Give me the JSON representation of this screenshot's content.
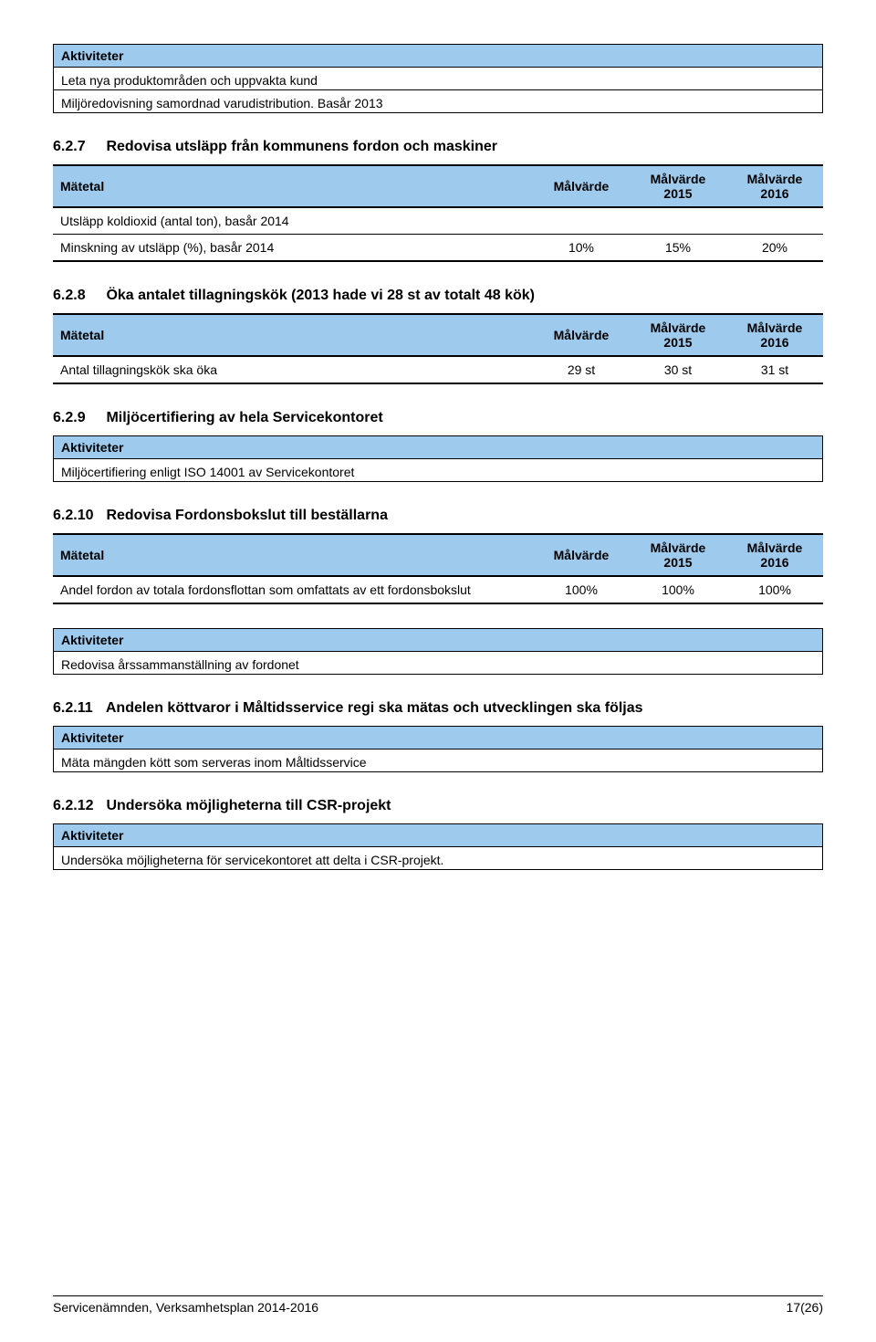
{
  "labels": {
    "aktiviteter": "Aktiviteter",
    "matetal": "Mätetal",
    "malvarde": "Målvärde",
    "malvarde_2015": "Målvärde\n2015",
    "malvarde_2016": "Målvärde\n2016"
  },
  "block_intro": {
    "lines": [
      "Leta nya produktområden och uppvakta kund",
      "Miljöredovisning samordnad varudistribution. Basår 2013"
    ]
  },
  "s627": {
    "num": "6.2.7",
    "title": "Redovisa utsläpp från kommunens fordon och maskiner",
    "rows": [
      {
        "label": "Utsläpp koldioxid (antal ton), basår 2014",
        "v1": "",
        "v2": "",
        "v3": ""
      },
      {
        "label": "Minskning av utsläpp (%), basår 2014",
        "v1": "10%",
        "v2": "15%",
        "v3": "20%"
      }
    ]
  },
  "s628": {
    "num": "6.2.8",
    "title": "Öka antalet tillagningskök (2013 hade vi 28 st av totalt 48 kök)",
    "rows": [
      {
        "label": "Antal tillagningskök ska öka",
        "v1": "29 st",
        "v2": "30 st",
        "v3": "31 st"
      }
    ]
  },
  "s629": {
    "num": "6.2.9",
    "title": "Miljöcertifiering av hela Servicekontoret",
    "activities": [
      "Miljöcertifiering enligt ISO 14001 av Servicekontoret"
    ]
  },
  "s6210": {
    "num": "6.2.10",
    "title": "Redovisa Fordonsbokslut till beställarna",
    "rows": [
      {
        "label": "Andel fordon av totala fordonsflottan som omfattats av ett fordonsbokslut",
        "v1": "100%",
        "v2": "100%",
        "v3": "100%"
      }
    ],
    "activities": [
      "Redovisa årssammanställning av fordonet"
    ]
  },
  "s6211": {
    "num": "6.2.11",
    "title": "Andelen köttvaror i Måltidsservice regi ska mätas och utvecklingen ska följas",
    "activities": [
      "Mäta mängden kött som serveras inom Måltidsservice"
    ]
  },
  "s6212": {
    "num": "6.2.12",
    "title": "Undersöka möjligheterna till CSR-projekt",
    "activities": [
      "Undersöka möjligheterna för servicekontoret att delta i CSR-projekt."
    ]
  },
  "footer": {
    "left": "Servicenämnden, Verksamhetsplan 2014-2016",
    "right": "17(26)"
  }
}
